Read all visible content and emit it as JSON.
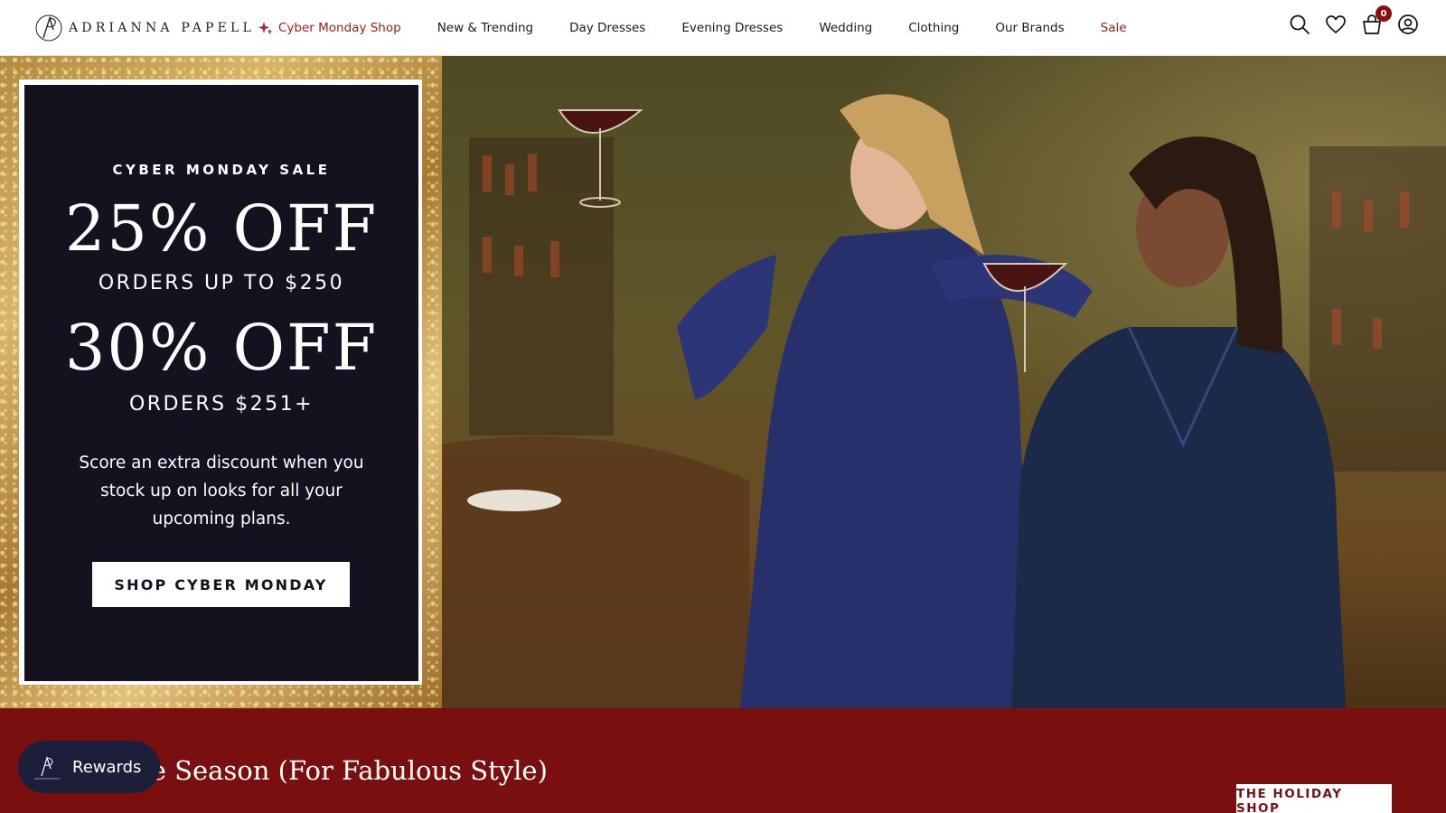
{
  "brand": {
    "name": "ADRIANNA PAPELL"
  },
  "nav": {
    "items": [
      {
        "label": "Cyber Monday Shop"
      },
      {
        "label": "New & Trending"
      },
      {
        "label": "Day Dresses"
      },
      {
        "label": "Evening Dresses"
      },
      {
        "label": "Wedding"
      },
      {
        "label": "Clothing"
      },
      {
        "label": "Our Brands"
      },
      {
        "label": "Sale"
      }
    ]
  },
  "header_icons": {
    "search": "search-icon",
    "wishlist": "heart-icon",
    "cart": "cart-icon",
    "account": "user-icon",
    "cart_count": "0"
  },
  "hero": {
    "eyebrow": "CYBER MONDAY SALE",
    "offer1_big": "25% OFF",
    "offer1_sub": "ORDERS UP TO $250",
    "offer2_big": "30% OFF",
    "offer2_sub": "ORDERS $251+",
    "body": "Score an extra discount when you stock up on looks for all your upcoming plans.",
    "cta": "SHOP CYBER MONDAY"
  },
  "band": {
    "title": "'Tis The Season (For Fabulous Style)",
    "button": "THE HOLIDAY SHOP"
  },
  "rewards": {
    "label": "Rewards"
  },
  "colors": {
    "accent_red": "#9b1c1c",
    "band_red": "#7a0f0f",
    "promo_dark": "#15111e",
    "rewards_navy": "#1c1f3a"
  }
}
